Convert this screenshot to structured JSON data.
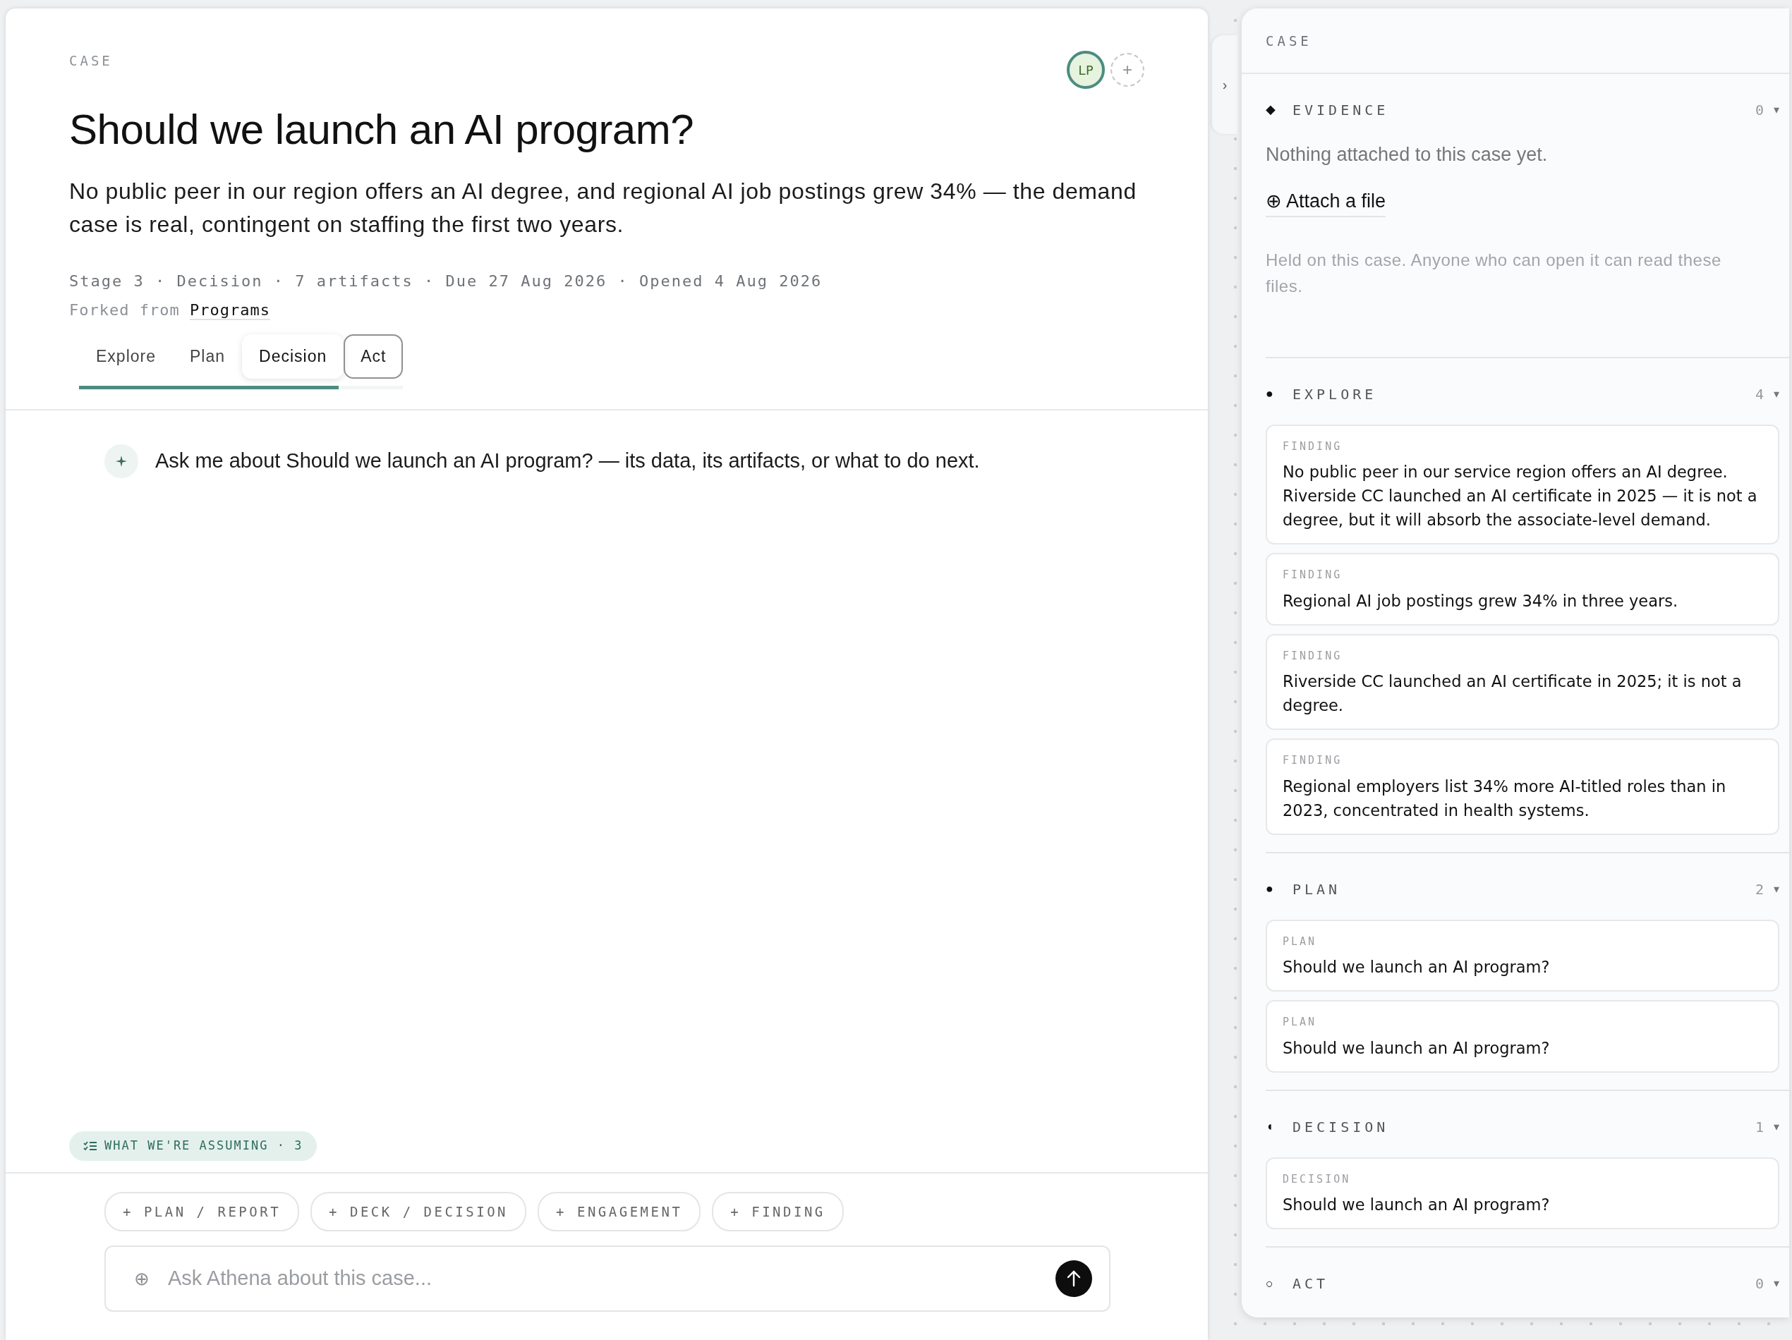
{
  "case_label": "CASE",
  "participants": [
    {
      "initials": "LP"
    }
  ],
  "add_participant": "+",
  "title": "Should we launch an AI program?",
  "summary": "No public peer in our region offers an AI degree, and regional AI job postings grew 34% — the demand case is real, contingent on staffing the first two years.",
  "meta": "Stage 3 · Decision · 7 artifacts · Due 27 Aug 2026 · Opened 4 Aug 2026",
  "forked": {
    "label": "Forked from",
    "link": "Programs"
  },
  "tabs": [
    {
      "label": "Explore",
      "selected": false,
      "outlined": false
    },
    {
      "label": "Plan",
      "selected": false,
      "outlined": false
    },
    {
      "label": "Decision",
      "selected": true,
      "outlined": false
    },
    {
      "label": "Act",
      "selected": false,
      "outlined": true
    }
  ],
  "stage_progress": {
    "level": 0.8
  },
  "assistant_message": "Ask me about Should we launch an AI program? — its data, its artifacts, or what to do next.",
  "assumptions_chip": "WHAT WE'RE ASSUMING · 3",
  "quick_actions": [
    "+ PLAN / REPORT",
    "+ DECK / DECISION",
    "+ ENGAGEMENT",
    "+ FINDING"
  ],
  "composer": {
    "attach": "⊕",
    "placeholder": "Ask Athena about this case..."
  },
  "panel": {
    "toggle": "›",
    "title": "CASE",
    "sections": [
      {
        "marker": "◆",
        "title": "EVIDENCE",
        "count": "0",
        "caret": "▾",
        "empty_text": "Nothing attached to this case yet.",
        "attach_link": "⊕ Attach a file",
        "note": "Held on this case. Anyone who can open it can read these files."
      },
      {
        "marker": "●",
        "title": "EXPLORE",
        "count": "4",
        "caret": "▾",
        "items": [
          {
            "kind": "FINDING",
            "text": "No public peer in our service region offers an AI degree. Riverside CC launched an AI certificate in 2025 — it is not a degree, but it will absorb the associate-level demand."
          },
          {
            "kind": "FINDING",
            "text": "Regional AI job postings grew 34% in three years."
          },
          {
            "kind": "FINDING",
            "text": "Riverside CC launched an AI certificate in 2025; it is not a degree."
          },
          {
            "kind": "FINDING",
            "text": "Regional employers list 34% more AI-titled roles than in 2023, concentrated in health systems."
          }
        ]
      },
      {
        "marker": "●",
        "title": "PLAN",
        "count": "2",
        "caret": "▾",
        "items": [
          {
            "kind": "PLAN",
            "text": "Should we launch an AI program?"
          },
          {
            "kind": "PLAN",
            "text": "Should we launch an AI program?"
          }
        ]
      },
      {
        "marker": "◖",
        "title": "DECISION",
        "count": "1",
        "caret": "▾",
        "items": [
          {
            "kind": "DECISION",
            "text": "Should we launch an AI program?"
          }
        ]
      },
      {
        "marker": "○",
        "title": "ACT",
        "count": "0",
        "caret": "▾"
      }
    ]
  }
}
